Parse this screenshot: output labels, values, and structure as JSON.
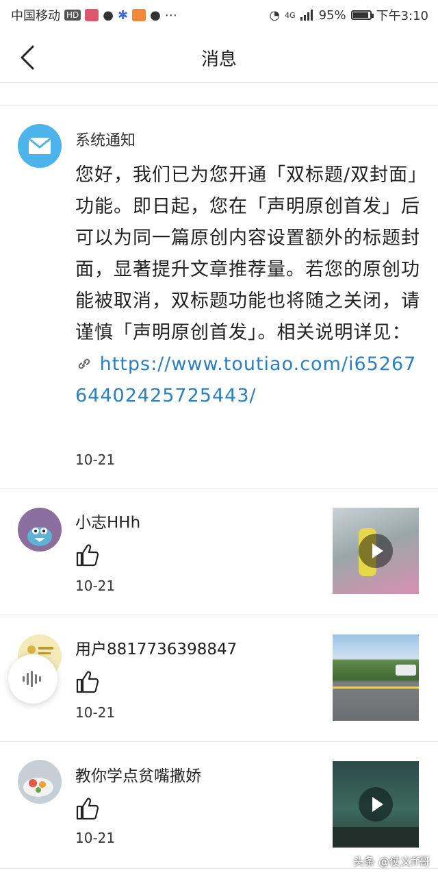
{
  "status_bar": {
    "carrier": "中国移动",
    "hd": "HD",
    "network": "4G",
    "battery": "95%",
    "battery_level": 0.95,
    "time": "下午3:10"
  },
  "nav": {
    "title": "消息"
  },
  "notice": {
    "sender": "系统通知",
    "body": "您好，我们已为您开通「双标题/双封面」功能。即日起，您在「声明原创首发」后可以为同一篇原创内容设置额外的标题封面，显著提升文章推荐量。若您的原创功能被取消，双标题功能也将随之关闭，请谨慎「声明原创首发」。相关说明详见：",
    "link": "https://www.toutiao.com/i6526764402425725443/",
    "date": "10-21"
  },
  "messages": [
    {
      "name": "小志HHh",
      "date": "10-21",
      "thumb_type": "video"
    },
    {
      "name": "用户8817736398847",
      "date": "10-21",
      "thumb_type": "image"
    },
    {
      "name": "教你学点贫嘴撒娇",
      "date": "10-21",
      "thumb_type": "video"
    }
  ],
  "watermark": "头条 @仗义ff哥",
  "colors": {
    "link": "#2c7fbe",
    "mail_avatar": "#4cb4ea"
  }
}
